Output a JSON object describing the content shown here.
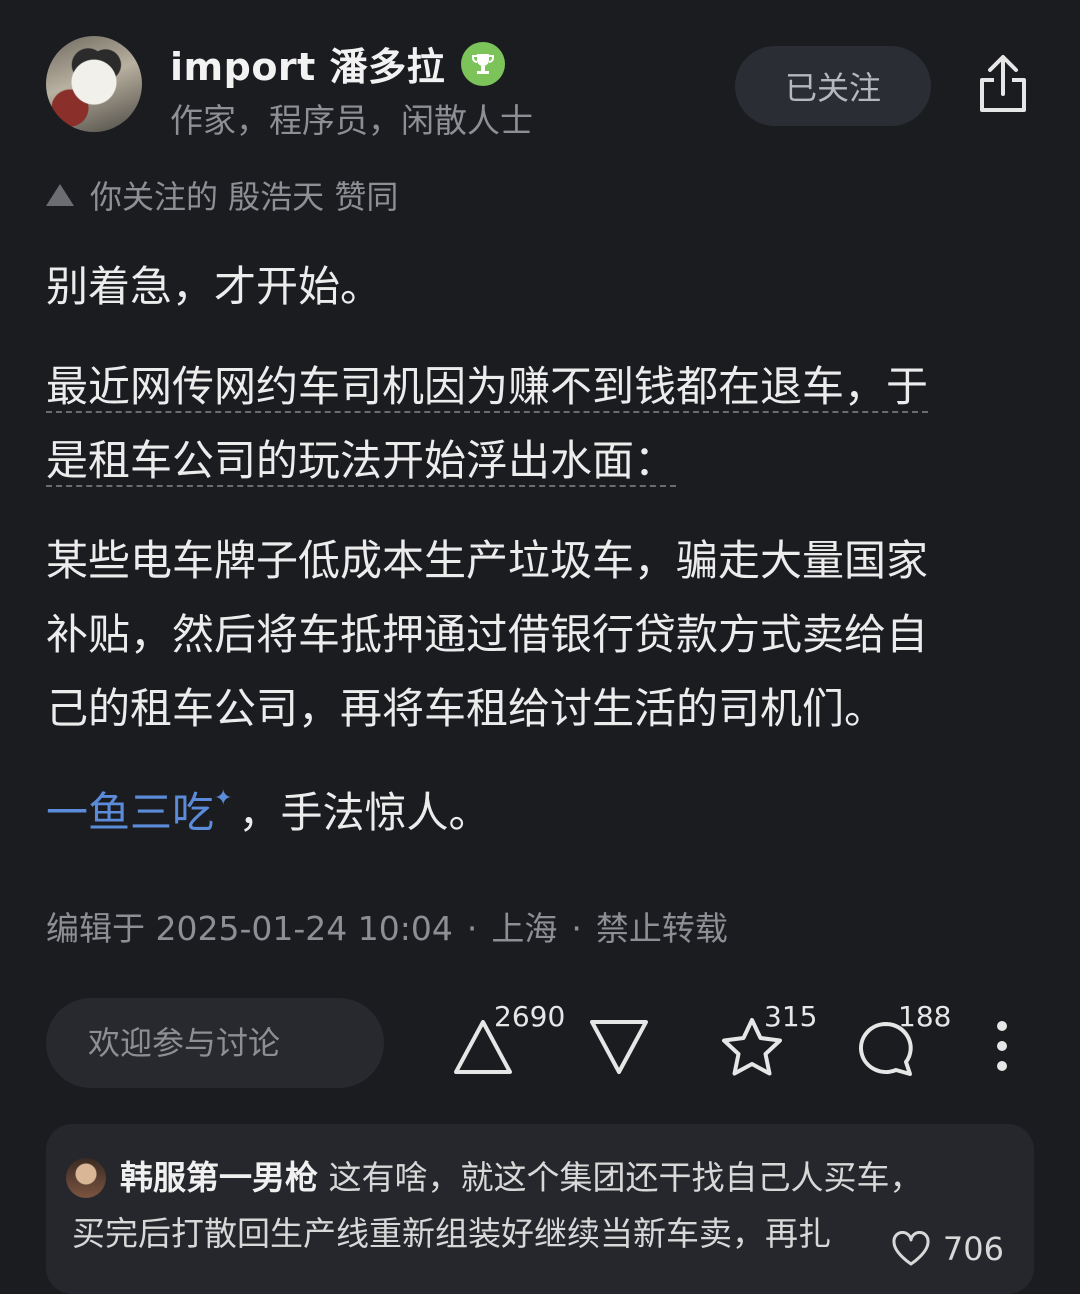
{
  "author": {
    "name": "import 潘多拉",
    "bio": "作家，程序员，闲散人士",
    "follow_label": "已关注"
  },
  "upvoted_note": "你关注的 殷浩天 赞同",
  "content": {
    "p1": "别着急，才开始。",
    "p2_line1": "最近网传网约车司机因为赚不到钱都在退车，于",
    "p2_line2": "是租车公司的玩法开始浮出水面：",
    "p3_line1": "某些电车牌子低成本生产垃圾车，骗走大量国家",
    "p3_line2": "补贴，然后将车抵押通过借银行贷款方式卖给自",
    "p3_line3": "己的租车公司，再将车租给讨生活的司机们。",
    "p4_link": "一鱼三吃",
    "p4_rest": "，手法惊人。"
  },
  "meta": {
    "edited": "编辑于 2025-01-24 10:04",
    "location": "上海",
    "rights": "禁止转载"
  },
  "actions": {
    "comment_placeholder": "欢迎参与讨论",
    "upvotes": "2690",
    "favorites": "315",
    "comments": "188"
  },
  "top_comment": {
    "user": "韩服第一男枪",
    "text_line1": "这有啥，就这个集团还干找自己人买车，",
    "text_line2": "买完后打散回生产线重新组装好继续当新车卖，再扎",
    "likes": "706"
  },
  "colors": {
    "background": "#1b1c20",
    "link": "#5b8bd9",
    "muted": "#8d8f95",
    "badge": "#7cc45a"
  },
  "icons": [
    "trophy-badge-icon",
    "share-icon",
    "upvote-icon",
    "downvote-icon",
    "star-icon",
    "comment-icon",
    "more-icon",
    "heart-icon"
  ]
}
